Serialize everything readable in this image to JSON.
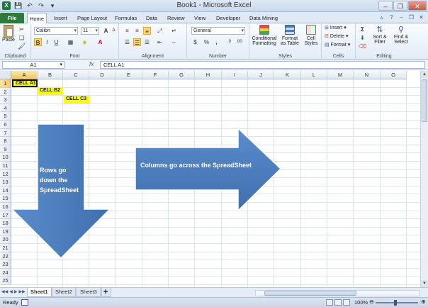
{
  "window": {
    "title": "Book1 - Microsoft Excel",
    "app_icon": "X",
    "controls": [
      "–",
      "❐",
      "✕"
    ]
  },
  "quick_access": [
    "💾",
    "↶",
    "↷",
    "▾"
  ],
  "ribbon_tabs": [
    "File",
    "Home",
    "Insert",
    "Page Layout",
    "Formulas",
    "Data",
    "Review",
    "View",
    "Developer",
    "Data Mining"
  ],
  "active_tab": "Home",
  "ribbon": {
    "clipboard": {
      "label": "Clipboard",
      "paste": "Paste"
    },
    "font": {
      "label": "Font",
      "name": "Calibri",
      "size": "11",
      "bold": "B",
      "italic": "I",
      "underline": "U",
      "grow": "A",
      "shrink": "A"
    },
    "alignment": {
      "label": "Alignment"
    },
    "number": {
      "label": "Number",
      "format": "General",
      "currency": "$",
      "percent": "%",
      "comma": ","
    },
    "styles": {
      "label": "Styles",
      "conditional": "Conditional",
      "conditional2": "Formatting",
      "format_table": "Format",
      "format_table2": "as Table",
      "cell_styles": "Cell",
      "cell_styles2": "Styles"
    },
    "cells": {
      "label": "Cells",
      "insert": "Insert",
      "delete": "Delete",
      "format": "Format"
    },
    "editing": {
      "label": "Editing",
      "sort": "Sort &",
      "sort2": "Filter",
      "find": "Find &",
      "find2": "Select"
    }
  },
  "formula_bar": {
    "name_box": "A1",
    "fx": "fx",
    "content": "CELL A1"
  },
  "columns": [
    "A",
    "B",
    "C",
    "D",
    "E",
    "F",
    "G",
    "H",
    "I",
    "J",
    "K",
    "L",
    "M",
    "N",
    "O"
  ],
  "rows": [
    "1",
    "2",
    "3",
    "4",
    "5",
    "6",
    "7",
    "8",
    "9",
    "10",
    "11",
    "12",
    "13",
    "14",
    "15",
    "16",
    "17",
    "18",
    "19",
    "20",
    "21",
    "22",
    "23",
    "24",
    "25"
  ],
  "cells": {
    "a1": "CELL A1",
    "b2": "CELL B2",
    "c3": "CELL C3"
  },
  "arrows": {
    "down_label_1": "Rows go",
    "down_label_2": "down the",
    "down_label_3": "SpreadSheet",
    "right_label": "Columns go across the SpreadSheet",
    "color": "#4a7ebb"
  },
  "sheets": [
    "Sheet1",
    "Sheet2",
    "Sheet3"
  ],
  "active_sheet": "Sheet1",
  "status": {
    "text": "Ready",
    "zoom": "100%"
  }
}
